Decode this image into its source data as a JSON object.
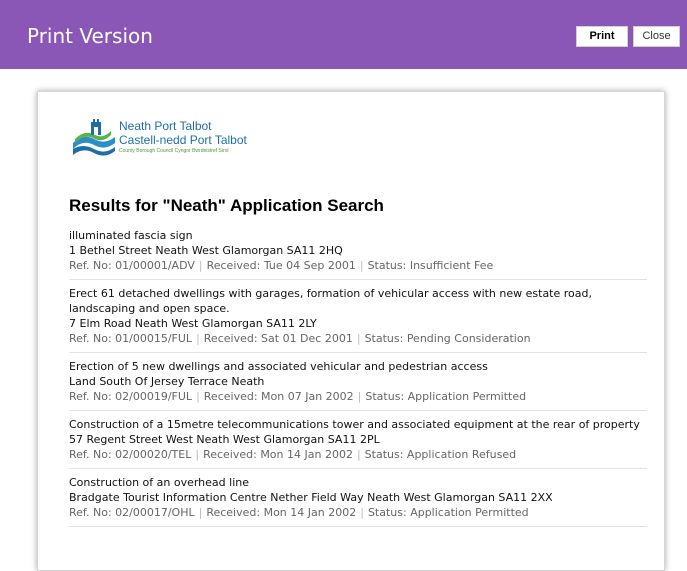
{
  "header": {
    "title": "Print Version",
    "print_label": "Print",
    "close_label": "Close",
    "bg_color": "#8a57b6"
  },
  "logo": {
    "line1": "Neath Port Talbot",
    "line2": "Castell-nedd Port Talbot",
    "line3": "County Borough Council  Cyngor Bwrdeistref Sirol"
  },
  "results_title": "Results for \"Neath\" Application Search",
  "results": [
    {
      "description": "illuminated fascia sign",
      "address": "1 Bethel Street Neath West Glamorgan SA11 2HQ",
      "ref": "Ref. No: 01/00001/ADV",
      "received": "Received: Tue 04 Sep 2001",
      "status": "Status: Insufficient Fee"
    },
    {
      "description": "Erect 61 detached dwellings with garages, formation of vehicular access with new estate road, landscaping and open space.",
      "address": "7 Elm Road Neath West Glamorgan SA11 2LY",
      "ref": "Ref. No: 01/00015/FUL",
      "received": "Received: Sat 01 Dec 2001",
      "status": "Status: Pending Consideration"
    },
    {
      "description": "Erection of 5 new dwellings and associated vehicular and pedestrian access",
      "address": "Land South Of Jersey Terrace Neath",
      "ref": "Ref. No: 02/00019/FUL",
      "received": "Received: Mon 07 Jan 2002",
      "status": "Status: Application Permitted"
    },
    {
      "description": "Construction of a 15metre telecommunications tower and associated equipment at the rear of property",
      "address": "57 Regent Street West Neath West Glamorgan SA11 2PL",
      "ref": "Ref. No: 02/00020/TEL",
      "received": "Received: Mon 14 Jan 2002",
      "status": "Status: Application Refused"
    },
    {
      "description": "Construction of an overhead line",
      "address": "Bradgate Tourist Information Centre Nether Field Way Neath West Glamorgan SA11 2XX",
      "ref": "Ref. No: 02/00017/OHL",
      "received": "Received: Mon 14 Jan 2002",
      "status": "Status: Application Permitted"
    }
  ]
}
